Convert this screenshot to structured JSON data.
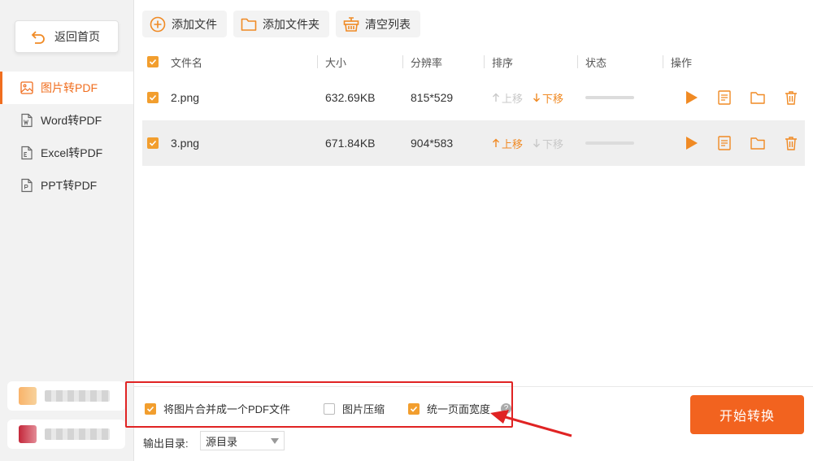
{
  "sidebar": {
    "back_label": "返回首页",
    "items": [
      {
        "label": "图片转PDF",
        "icon": "image-file-icon",
        "active": true
      },
      {
        "label": "Word转PDF",
        "icon": "word-file-icon",
        "active": false
      },
      {
        "label": "Excel转PDF",
        "icon": "excel-file-icon",
        "active": false
      },
      {
        "label": "PPT转PDF",
        "icon": "ppt-file-icon",
        "active": false
      }
    ]
  },
  "toolbar": {
    "add_file": "添加文件",
    "add_folder": "添加文件夹",
    "clear_list": "清空列表"
  },
  "table": {
    "headers": {
      "name": "文件名",
      "size": "大小",
      "resolution": "分辨率",
      "sort": "排序",
      "status": "状态",
      "ops": "操作"
    },
    "sort_up": "上移",
    "sort_down": "下移",
    "rows": [
      {
        "name": "2.png",
        "size": "632.69KB",
        "resolution": "815*529",
        "checked": true
      },
      {
        "name": "3.png",
        "size": "671.84KB",
        "resolution": "904*583",
        "checked": true
      }
    ]
  },
  "options": {
    "merge_label": "将图片合并成一个PDF文件",
    "merge_checked": true,
    "compress_label": "图片压缩",
    "compress_checked": false,
    "uniform_label": "统一页面宽度",
    "uniform_checked": true,
    "help_glyph": "?"
  },
  "output": {
    "label": "输出目录:",
    "value": "源目录"
  },
  "start_label": "开始转换",
  "colors": {
    "accent": "#f06e1f",
    "start_button": "#f2631f",
    "highlight_box": "#e02323"
  }
}
